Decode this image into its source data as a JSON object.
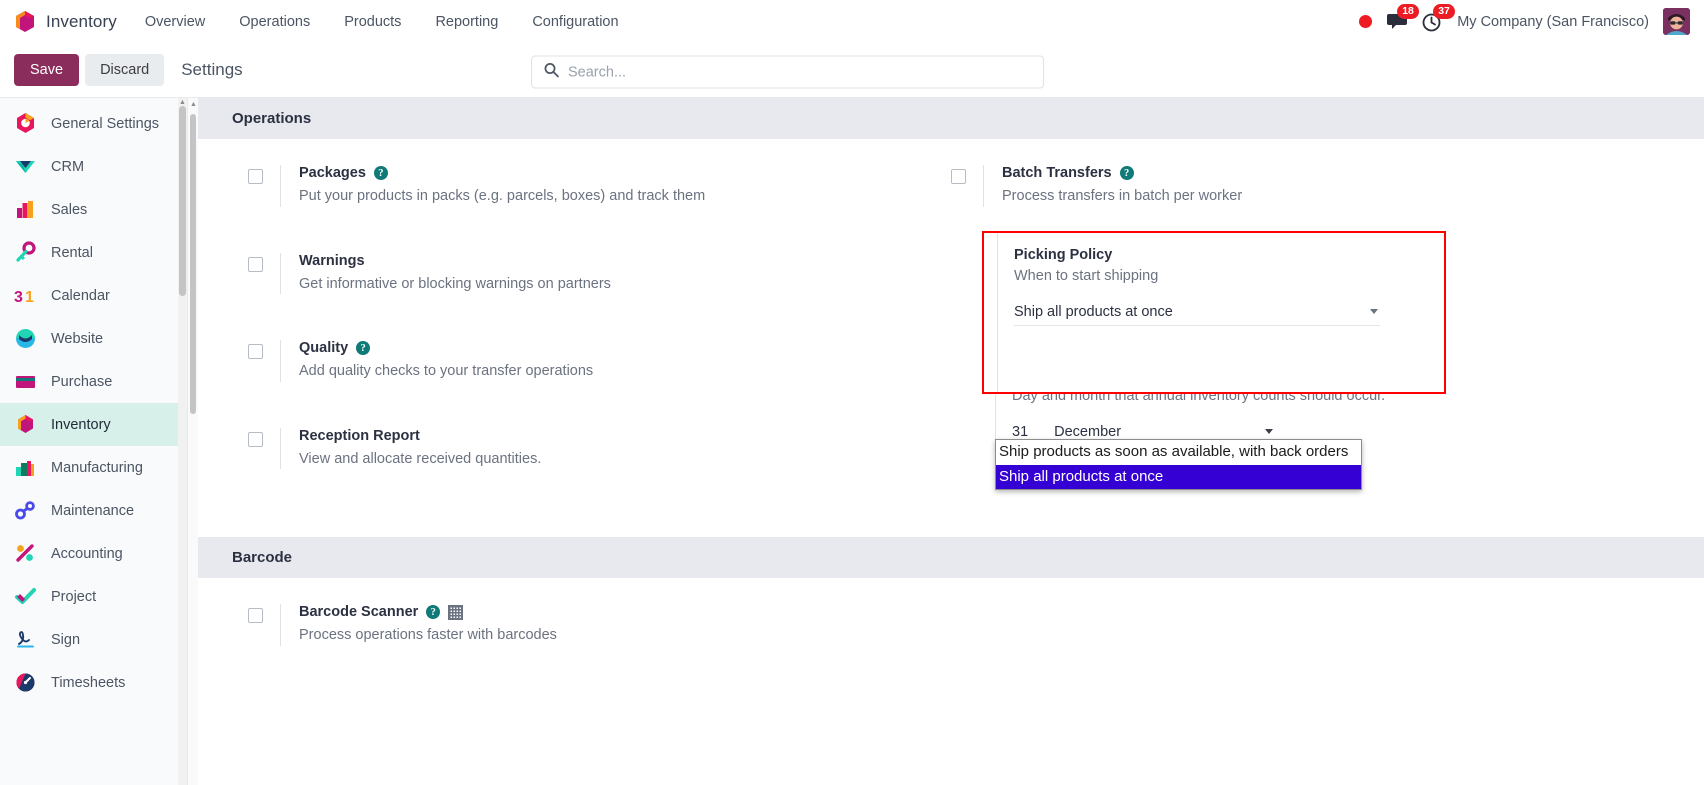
{
  "navbar": {
    "brand": "Inventory",
    "brand_icon": "inventory-hexagon-icon",
    "menu": [
      "Overview",
      "Operations",
      "Products",
      "Reporting",
      "Configuration"
    ],
    "status_dot_color": "#ed1c24",
    "messages_badge": "18",
    "activities_badge": "37",
    "company": "My Company (San Francisco)",
    "avatar": "user-avatar"
  },
  "control_panel": {
    "save_label": "Save",
    "discard_label": "Discard",
    "page_title": "Settings",
    "search_placeholder": "Search...",
    "search_value": ""
  },
  "sidebar": {
    "items": [
      {
        "label": "General Settings",
        "icon": "settings-app-icon",
        "active": false
      },
      {
        "label": "CRM",
        "icon": "crm-app-icon",
        "active": false
      },
      {
        "label": "Sales",
        "icon": "sales-app-icon",
        "active": false
      },
      {
        "label": "Rental",
        "icon": "rental-app-icon",
        "active": false
      },
      {
        "label": "Calendar",
        "icon": "calendar-app-icon",
        "active": false
      },
      {
        "label": "Website",
        "icon": "website-app-icon",
        "active": false
      },
      {
        "label": "Purchase",
        "icon": "purchase-app-icon",
        "active": false
      },
      {
        "label": "Inventory",
        "icon": "inventory-app-icon",
        "active": true
      },
      {
        "label": "Manufacturing",
        "icon": "manufacturing-app-icon",
        "active": false
      },
      {
        "label": "Maintenance",
        "icon": "maintenance-app-icon",
        "active": false
      },
      {
        "label": "Accounting",
        "icon": "accounting-app-icon",
        "active": false
      },
      {
        "label": "Project",
        "icon": "project-app-icon",
        "active": false
      },
      {
        "label": "Sign",
        "icon": "sign-app-icon",
        "active": false
      },
      {
        "label": "Timesheets",
        "icon": "timesheets-app-icon",
        "active": false
      }
    ]
  },
  "sections": {
    "operations": {
      "header": "Operations",
      "packages": {
        "title": "Packages",
        "desc": "Put your products in packs (e.g. parcels, boxes) and track them",
        "checked": false,
        "has_help": true
      },
      "warnings": {
        "title": "Warnings",
        "desc": "Get informative or blocking warnings on partners",
        "checked": false,
        "has_help": false
      },
      "quality": {
        "title": "Quality",
        "desc": "Add quality checks to your transfer operations",
        "checked": false,
        "has_help": true
      },
      "reception_report": {
        "title": "Reception Report",
        "desc": "View and allocate received quantities.",
        "checked": false,
        "has_help": false
      },
      "batch_transfers": {
        "title": "Batch Transfers",
        "desc": "Process transfers in batch per worker",
        "checked": false,
        "has_help": true
      },
      "picking_policy": {
        "title": "Picking Policy",
        "desc": "When to start shipping",
        "selected": "Ship all products at once",
        "options": [
          "Ship products as soon as available, with back orders",
          "Ship all products at once"
        ],
        "highlight_color": "#ff0000",
        "option_highlight_color": "#3500d3"
      },
      "annual_inventory": {
        "desc": "Day and month that annual inventory counts should occur.",
        "day": "31",
        "month": "December"
      }
    },
    "barcode": {
      "header": "Barcode",
      "barcode_scanner": {
        "title": "Barcode Scanner",
        "desc": "Process operations faster with barcodes",
        "checked": false,
        "has_help": true,
        "has_grid_icon": true
      }
    }
  }
}
